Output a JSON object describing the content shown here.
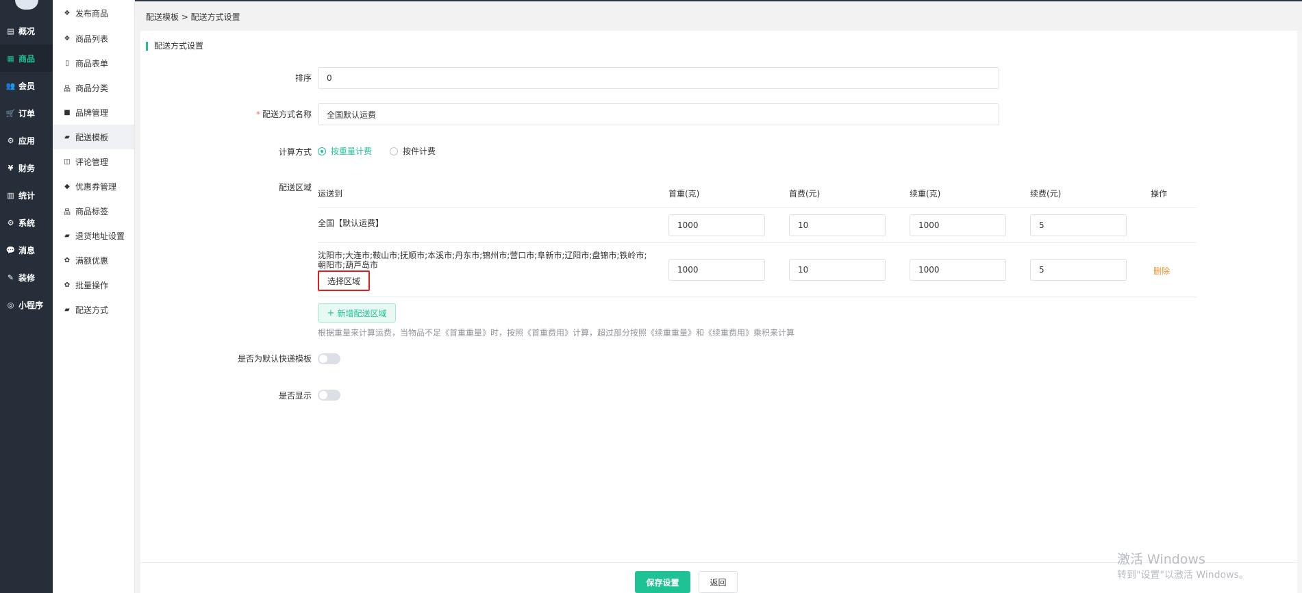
{
  "nav": {
    "items": [
      {
        "label": "概况",
        "icon": "overview-icon",
        "glyph": "▤"
      },
      {
        "label": "商品",
        "icon": "goods-icon",
        "glyph": "▦"
      },
      {
        "label": "会员",
        "icon": "members-icon",
        "glyph": "👥"
      },
      {
        "label": "订单",
        "icon": "cart-icon",
        "glyph": "🛒"
      },
      {
        "label": "应用",
        "icon": "apps-icon",
        "glyph": "⚙"
      },
      {
        "label": "财务",
        "icon": "yen-icon",
        "glyph": "¥"
      },
      {
        "label": "统计",
        "icon": "chart-icon",
        "glyph": "▥"
      },
      {
        "label": "系统",
        "icon": "cogs-icon",
        "glyph": "⚙"
      },
      {
        "label": "消息",
        "icon": "chat-icon",
        "glyph": "💬"
      },
      {
        "label": "装修",
        "icon": "wrench-icon",
        "glyph": "✎"
      },
      {
        "label": "小程序",
        "icon": "wechat-icon",
        "glyph": "◎"
      }
    ],
    "active_color": "#1ec295"
  },
  "submenu": {
    "items": [
      {
        "label": "发布商品",
        "icon": "cubes-icon",
        "glyph": "❖"
      },
      {
        "label": "商品列表",
        "icon": "cubes-icon",
        "glyph": "❖"
      },
      {
        "label": "商品表单",
        "icon": "file-icon",
        "glyph": "▯"
      },
      {
        "label": "商品分类",
        "icon": "sitemap-icon",
        "glyph": "品"
      },
      {
        "label": "品牌管理",
        "icon": "briefcase-icon",
        "glyph": "■"
      },
      {
        "label": "配送模板",
        "icon": "truck-icon",
        "glyph": "▰"
      },
      {
        "label": "评论管理",
        "icon": "columns-icon",
        "glyph": "◫"
      },
      {
        "label": "优惠券管理",
        "icon": "tags-icon",
        "glyph": "◆"
      },
      {
        "label": "商品标签",
        "icon": "sitemap-icon",
        "glyph": "品"
      },
      {
        "label": "退货地址设置",
        "icon": "truck-icon",
        "glyph": "▰"
      },
      {
        "label": "满额优惠",
        "icon": "gift-icon",
        "glyph": "✿"
      },
      {
        "label": "批量操作",
        "icon": "gift-icon",
        "glyph": "✿"
      },
      {
        "label": "配送方式",
        "icon": "truck-icon",
        "glyph": "▰"
      }
    ]
  },
  "breadcrumb": "配送模板 > 配送方式设置",
  "section_title": "配送方式设置",
  "form": {
    "sort_label": "排序",
    "sort_value": "0",
    "name_required_mark": "*",
    "name_label": "配送方式名称",
    "name_value": "全国默认运费",
    "calc_label": "计算方式",
    "calc_options": [
      "按重量计费",
      "按件计费"
    ],
    "calc_selected": "按重量计费",
    "area_label": "配送区域",
    "default_template_label": "是否为默认快递模板",
    "default_template_on": false,
    "show_label": "是否显示",
    "show_on": false
  },
  "table": {
    "headers": [
      "运送到",
      "首重(克)",
      "首费(元)",
      "续重(克)",
      "续费(元)",
      "操作"
    ],
    "rows": [
      {
        "region": "全国【默认运费】",
        "first_weight": "1000",
        "first_fee": "10",
        "extra_weight": "1000",
        "extra_fee": "5",
        "action": ""
      },
      {
        "region_line1": "沈阳市;大连市;鞍山市;抚顺市;本溪市;丹东市;锦州市;营口市;阜新市;辽阳市;盘锦市;铁岭市;",
        "region_line2": "朝阳市;葫芦岛市",
        "select_label": "选择区域",
        "first_weight": "1000",
        "first_fee": "10",
        "extra_weight": "1000",
        "extra_fee": "5",
        "action": "删除"
      }
    ],
    "add_label": "新增配送区域",
    "hint": "根据重量来计算运费，当物品不足《首重重量》时，按照《首重费用》计算，超过部分按照《续重重量》和《续重费用》乘积来计算"
  },
  "buttons": {
    "save": "保存设置",
    "back": "返回"
  },
  "watermark": {
    "line1": "激活 Windows",
    "line2": "转到\"设置\"以激活 Windows。"
  },
  "colors": {
    "accent": "#1ec295",
    "nav_bg": "#262e3a",
    "delete": "#f7902f",
    "highlight_border": "#e01e1e"
  }
}
